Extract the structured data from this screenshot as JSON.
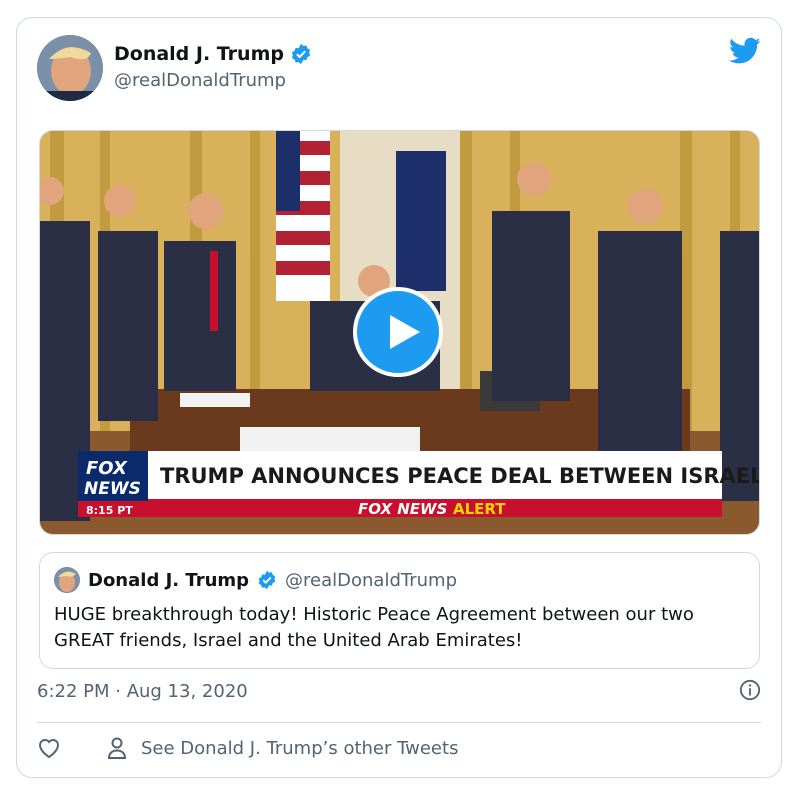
{
  "author": {
    "name": "Donald J. Trump",
    "handle": "@realDonaldTrump"
  },
  "icons": {
    "verified": "verified-badge-icon",
    "brand": "twitter-bird-icon",
    "play": "play-icon",
    "info": "info-icon",
    "like": "heart-icon",
    "profile": "person-icon"
  },
  "colors": {
    "brand": "#1d9bf0",
    "text": "#0f1419",
    "secondary": "#536471",
    "border": "#cfd9de",
    "fox_red": "#c8102e",
    "fox_blue": "#0a2a6b"
  },
  "video": {
    "chyron": "TRUMP ANNOUNCES PEACE DEAL BETWEEN ISRAEL & UAE",
    "logo_top": "FOX",
    "logo_bottom": "NEWS",
    "time": "8:15 PT",
    "alert_brand": "FOX NEWS",
    "alert_word": "ALERT"
  },
  "quoted": {
    "name": "Donald J. Trump",
    "handle": "@realDonaldTrump",
    "text": "HUGE breakthrough today! Historic Peace Agreement between our two GREAT friends, Israel and the United Arab Emirates!"
  },
  "timestamp": "6:22 PM · Aug 13, 2020",
  "actions": {
    "see_more": "See Donald J. Trump’s other Tweets"
  }
}
